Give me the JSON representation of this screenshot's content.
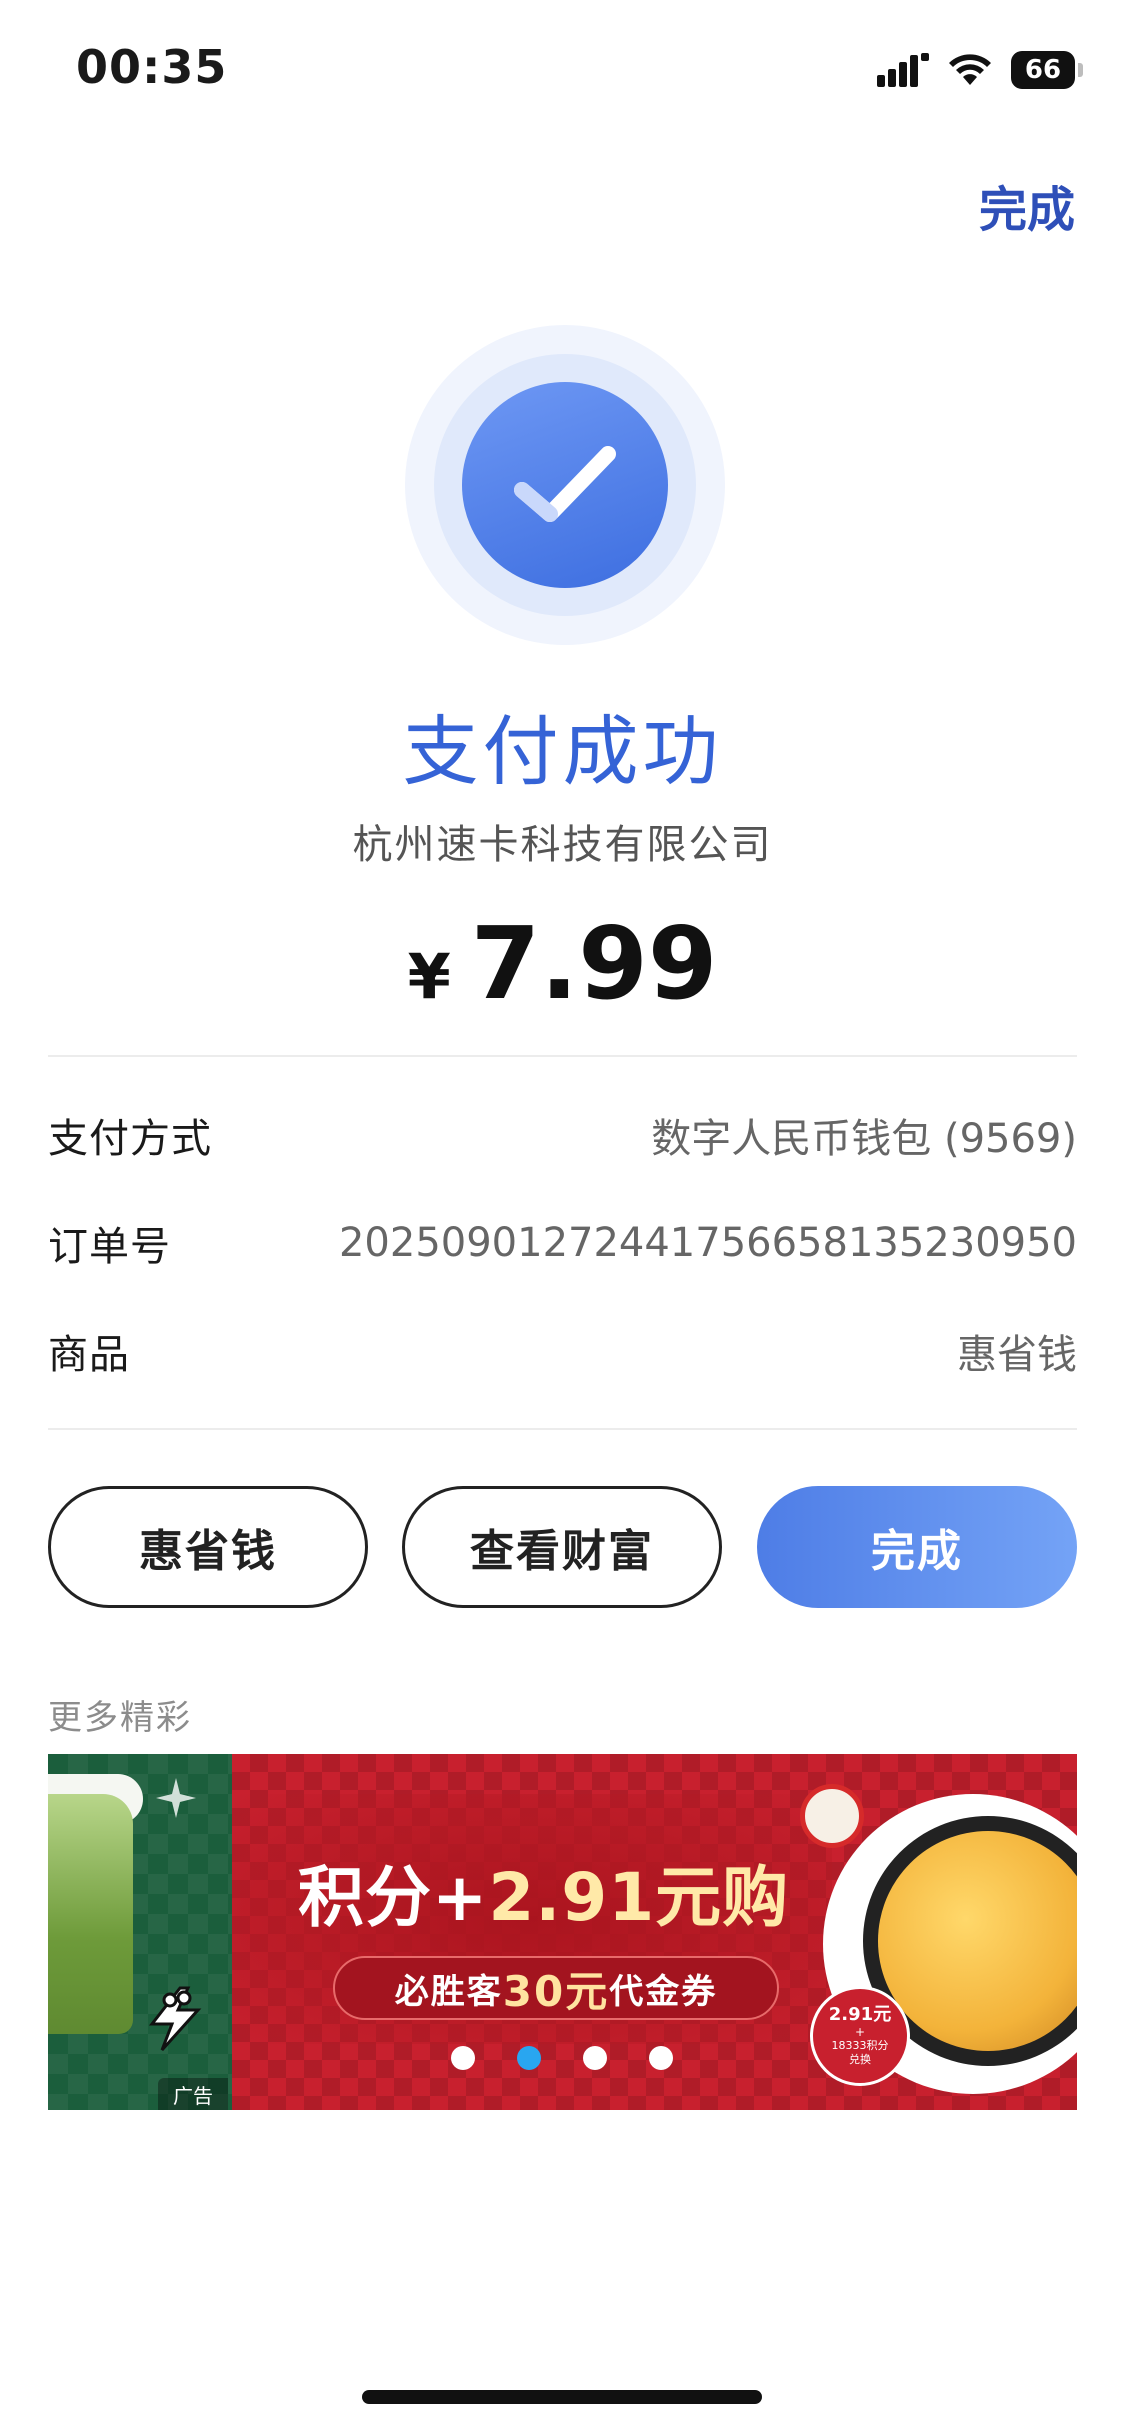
{
  "status_bar": {
    "time": "00:35",
    "battery": "66"
  },
  "header": {
    "done_link": "完成"
  },
  "result": {
    "title": "支付成功",
    "merchant": "杭州速卡科技有限公司",
    "currency": "¥",
    "amount": "7.99"
  },
  "details": [
    {
      "label": "支付方式",
      "value": "数字人民币钱包 (9569)"
    },
    {
      "label": "订单号",
      "value": "2025090127244175665813523095​0"
    },
    {
      "label": "商品",
      "value": "惠省钱"
    }
  ],
  "buttons": {
    "left": "惠省钱",
    "middle": "查看财富",
    "primary": "完成"
  },
  "more": {
    "label": "更多精彩"
  },
  "banner": {
    "title_prefix": "积分+",
    "title_highlight": "2.91元购",
    "pill_prefix": "必胜客",
    "pill_highlight": "30元",
    "pill_suffix": "代金券",
    "badge_price": "2.91元",
    "badge_plus": "+",
    "badge_points": "18333积分",
    "badge_action": "兑换",
    "ad_tag": "广告",
    "active_dot": 1,
    "dot_count": 4
  },
  "colors": {
    "accent": "#3563d6",
    "primary_button": "#4e7de6",
    "dot_active": "#29a6f0"
  }
}
